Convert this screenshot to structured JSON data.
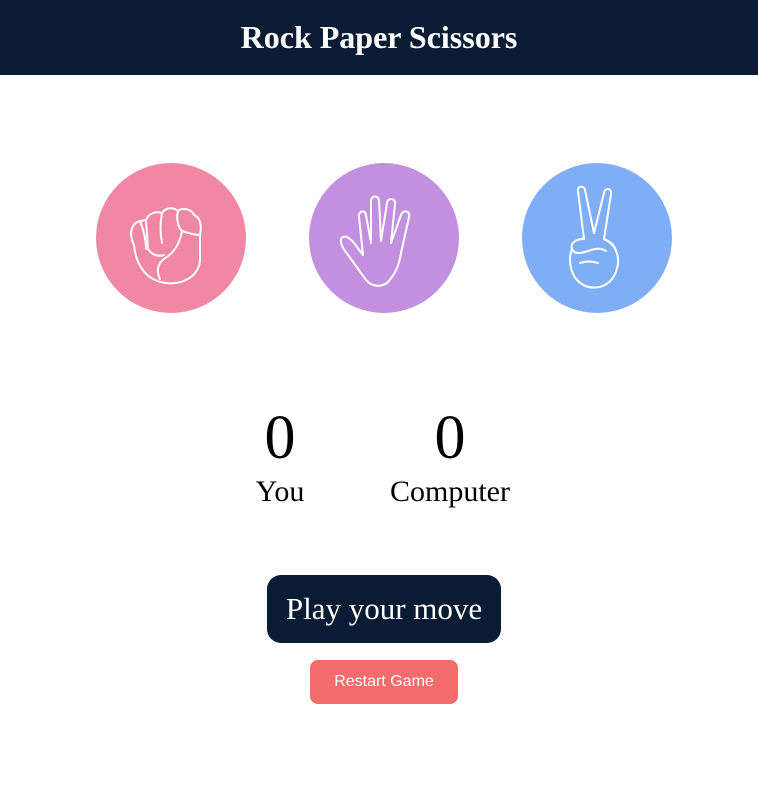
{
  "header": {
    "title": "Rock Paper Scissors"
  },
  "choices": [
    {
      "id": "rock",
      "icon": "fist-icon",
      "color": "#f087a3"
    },
    {
      "id": "paper",
      "icon": "open-hand-icon",
      "color": "#c390df"
    },
    {
      "id": "scissors",
      "icon": "peace-sign-hand-icon",
      "color": "#7faef7"
    }
  ],
  "scoreboard": {
    "you": {
      "score": "0",
      "label": "You"
    },
    "computer": {
      "score": "0",
      "label": "Computer"
    }
  },
  "actions": {
    "play_label": "Play your move",
    "restart_label": "Restart Game"
  },
  "colors": {
    "header_bg": "#0a1c33",
    "play_bg": "#0a1c33",
    "restart_bg": "#f56c6c"
  }
}
